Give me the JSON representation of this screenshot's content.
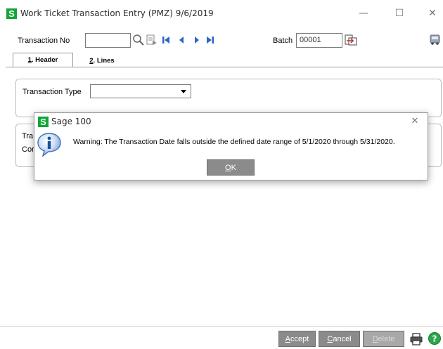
{
  "window": {
    "title": "Work Ticket Transaction Entry (PMZ) 9/6/2019",
    "logo_letter": "S",
    "minimize": "—",
    "maximize": "☐",
    "close": "✕"
  },
  "toolbar": {
    "transaction_no_label": "Transaction No",
    "transaction_no_value": "",
    "batch_label": "Batch",
    "batch_value": "00001"
  },
  "tabs": [
    {
      "num": "1",
      "label": ". Header",
      "active": true
    },
    {
      "num": "2",
      "label": ". Lines",
      "active": false
    }
  ],
  "header": {
    "transaction_type_label": "Transaction Type",
    "transaction_type_value": "",
    "partial_label_1": "Tra",
    "partial_label_2": "Cor"
  },
  "dialog": {
    "title": "Sage 100",
    "logo_letter": "S",
    "close": "✕",
    "message": "Warning: The Transaction Date falls outside the defined date range of 5/1/2020 through 5/31/2020.",
    "ok_mnemonic": "O",
    "ok_rest": "K"
  },
  "footer": {
    "accept_mnemonic": "A",
    "accept_rest": "ccept",
    "cancel_mnemonic": "C",
    "cancel_rest": "ancel",
    "delete_mnemonic": "D",
    "delete_rest": "elete"
  },
  "colors": {
    "sage_green": "#11a537",
    "nav_blue": "#2d66c2",
    "button_gray": "#8b8b8b",
    "info_blue": "#2f6fc6"
  }
}
